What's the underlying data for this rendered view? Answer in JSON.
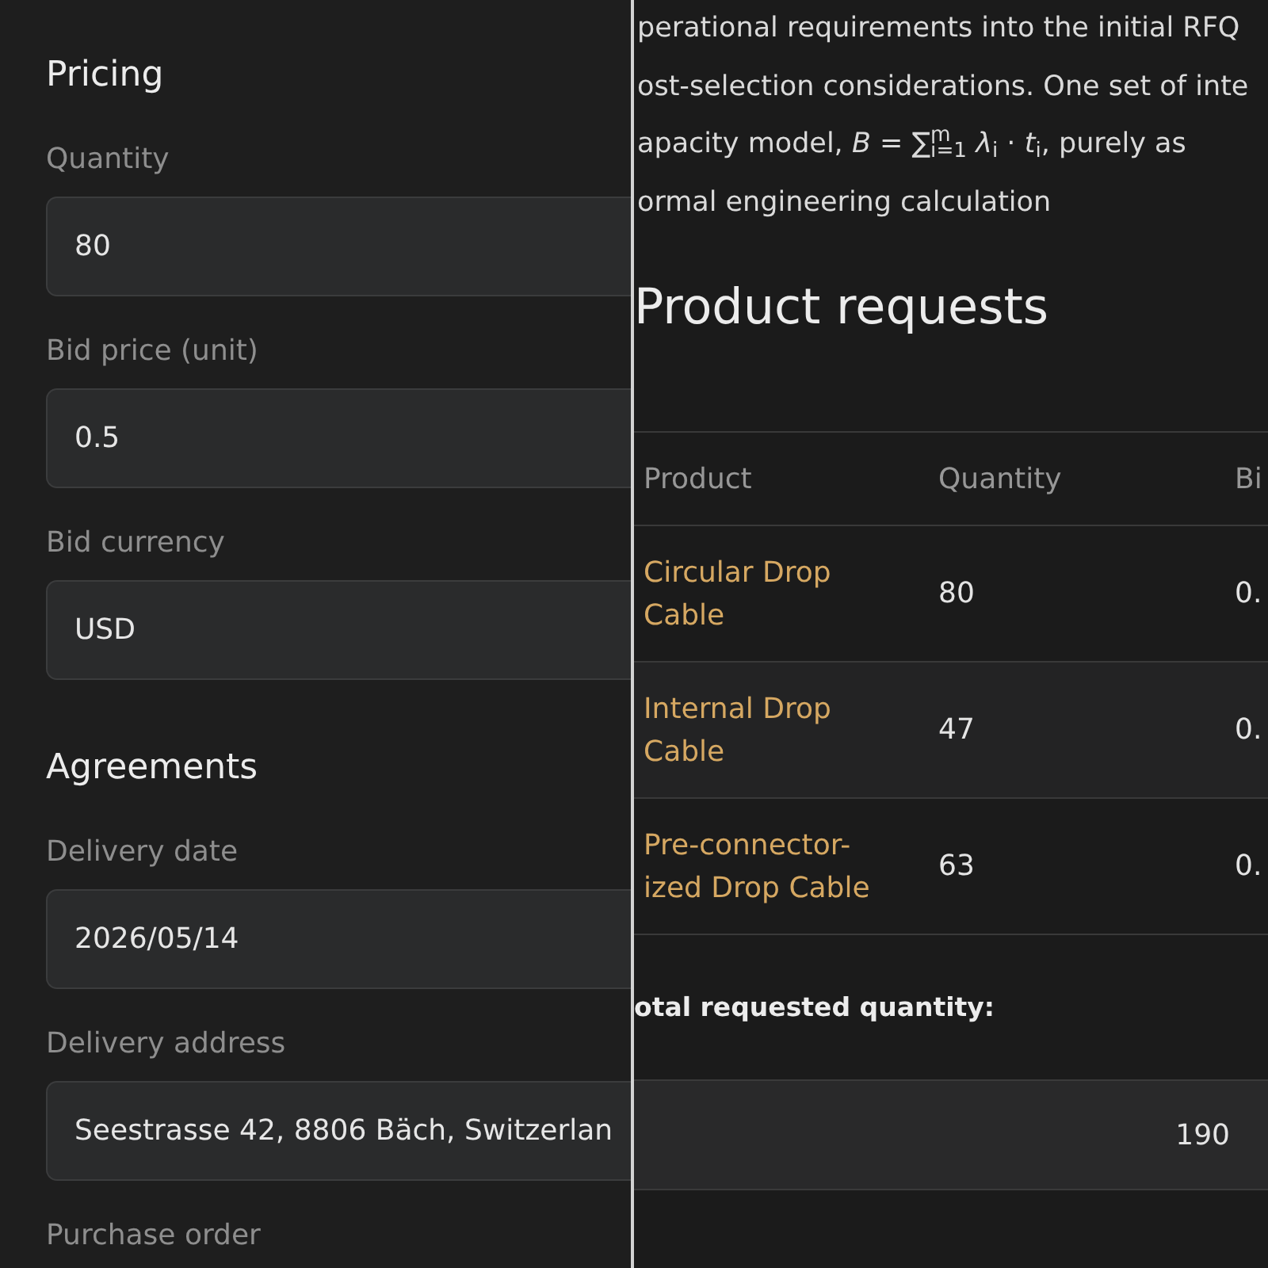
{
  "form": {
    "sections": [
      {
        "title": "Pricing",
        "fields": [
          {
            "label": "Quantity",
            "value": "80"
          },
          {
            "label": "Bid price (unit)",
            "value": "0.5"
          },
          {
            "label": "Bid currency",
            "value": "USD"
          }
        ]
      },
      {
        "title": "Agreements",
        "fields": [
          {
            "label": "Delivery date",
            "value": "2026/05/14"
          },
          {
            "label": "Delivery address",
            "value": "Seestrasse 42, 8806 Bäch, Switzerlan"
          },
          {
            "label": "Purchase order"
          }
        ]
      }
    ]
  },
  "document": {
    "paragraph_lines": [
      "perational requirements into the initial RFQ",
      "ost-selection considerations. One set of inte",
      "apacity model, *B* = ∑$^{m}$$_{i=1}$ *λ*$_{i}$ · *t*$_{i}$, purely as",
      "ormal engineering calculation"
    ],
    "heading": "Product requests",
    "table": {
      "columns": [
        "Product",
        "Quantity",
        "Bi"
      ],
      "rows": [
        [
          "Circular Drop Cable",
          "80",
          "0."
        ],
        [
          "Internal Drop Cable",
          "47",
          "0."
        ],
        [
          "Pre-connector-ized Drop Cable",
          "63",
          "0."
        ]
      ]
    },
    "total_label": "otal requested quantity:",
    "total_value": "190"
  }
}
